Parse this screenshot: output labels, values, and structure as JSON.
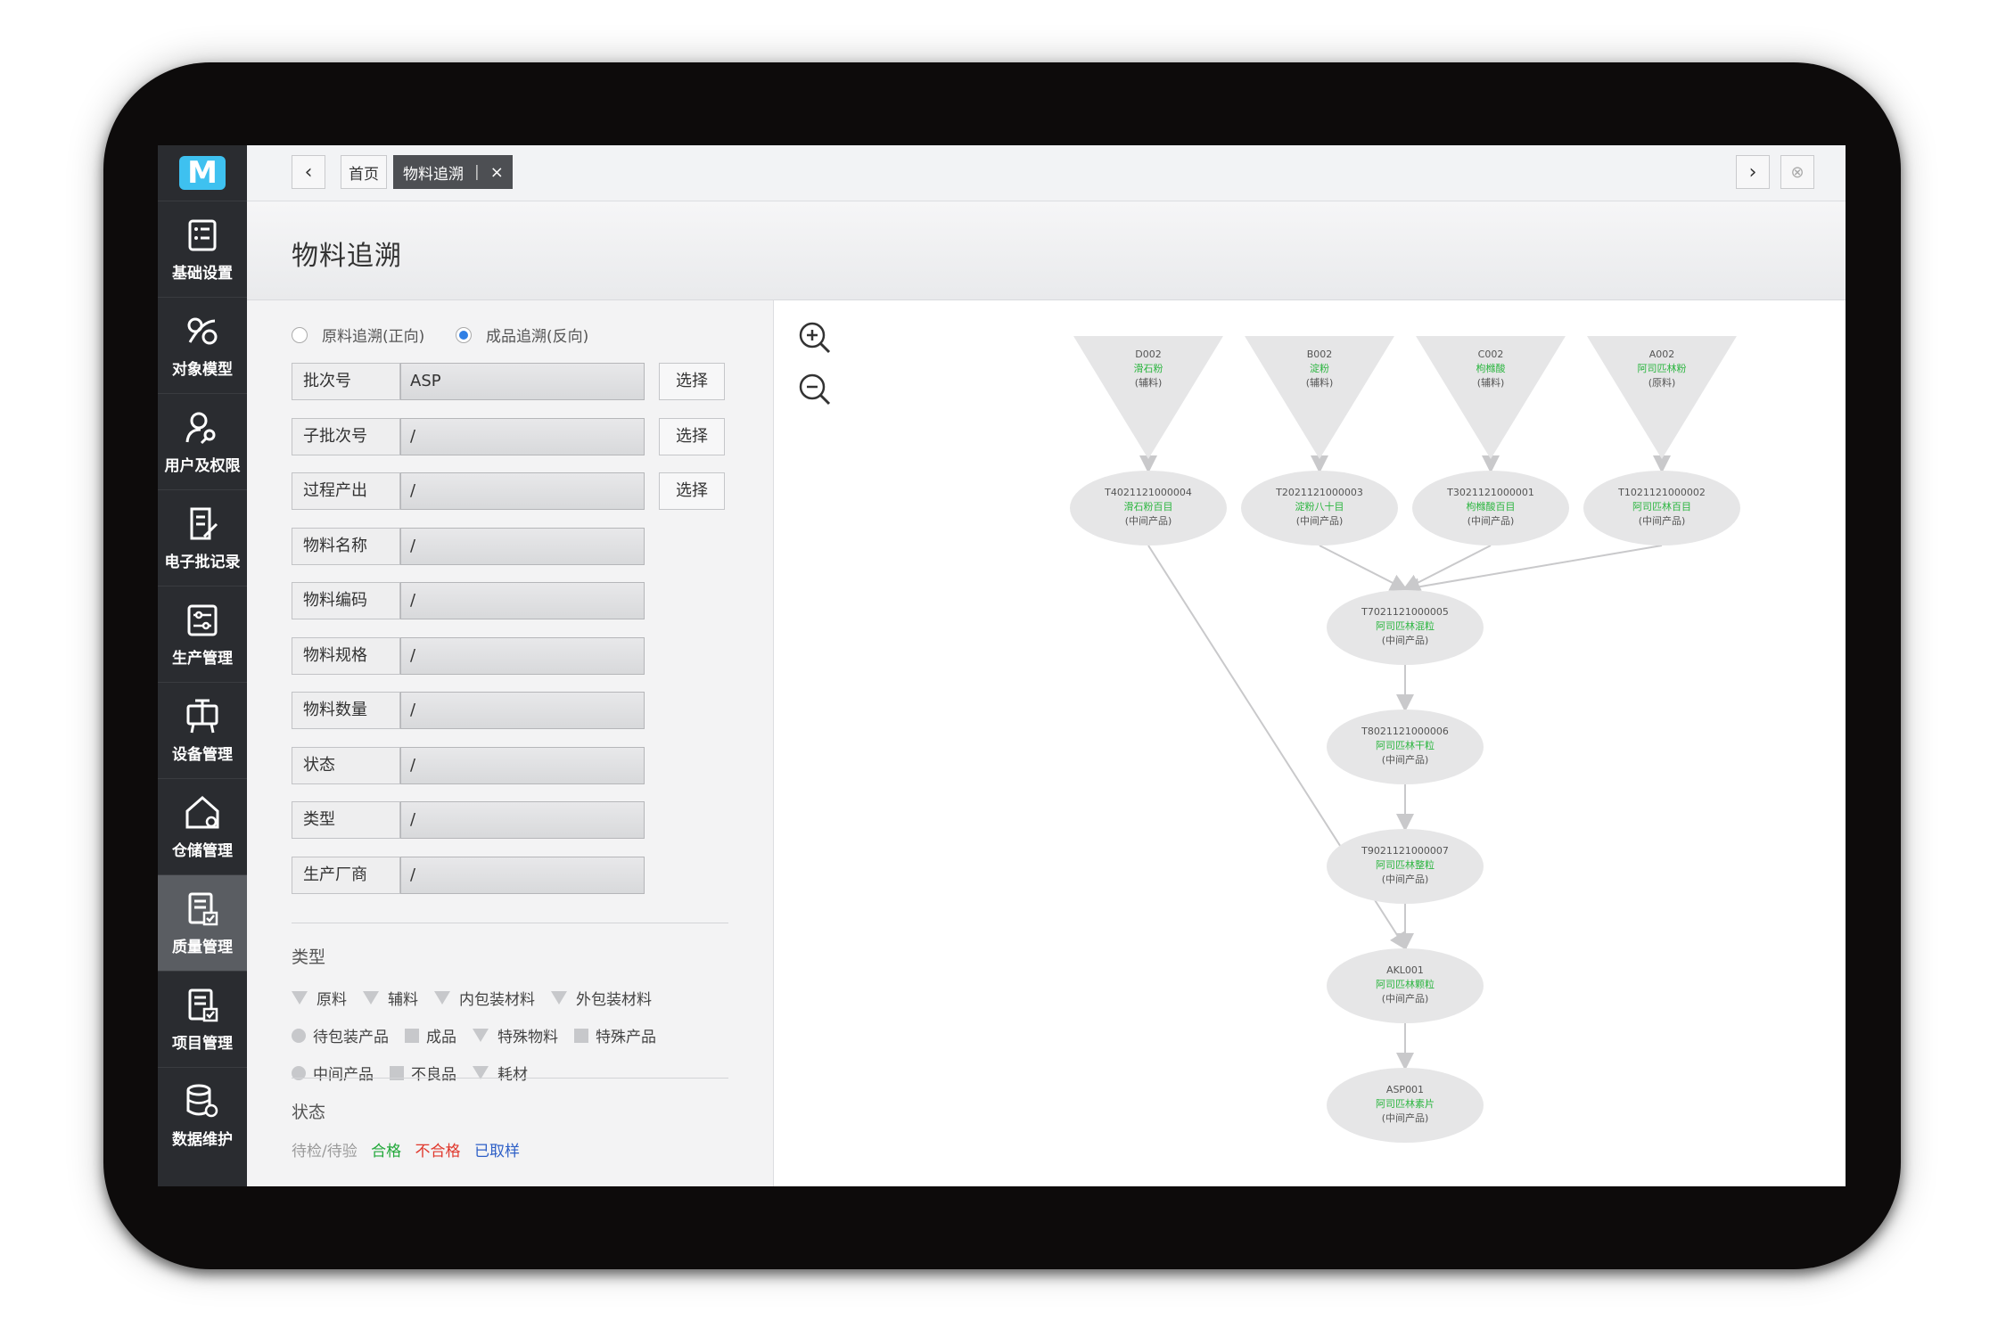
{
  "sidebar": {
    "logo": "M",
    "items": [
      {
        "label": "基础设置",
        "icon": "checklist-icon"
      },
      {
        "label": "对象模型",
        "icon": "model-link-icon"
      },
      {
        "label": "用户及权限",
        "icon": "user-key-icon"
      },
      {
        "label": "电子批记录",
        "icon": "document-edit-icon"
      },
      {
        "label": "生产管理",
        "icon": "sliders-icon"
      },
      {
        "label": "设备管理",
        "icon": "equipment-icon"
      },
      {
        "label": "仓储管理",
        "icon": "warehouse-icon"
      },
      {
        "label": "质量管理",
        "icon": "quality-check-icon",
        "active": true
      },
      {
        "label": "项目管理",
        "icon": "project-check-icon"
      },
      {
        "label": "数据维护",
        "icon": "database-gear-icon"
      }
    ]
  },
  "tabbar": {
    "prev": "‹",
    "next": "›",
    "close_all": "⊗",
    "tabs": [
      {
        "label": "首页"
      },
      {
        "label": "物料追溯",
        "active": true,
        "close": "×"
      }
    ]
  },
  "page": {
    "title": "物料追溯"
  },
  "trace_mode": {
    "forward": "原料追溯(正向)",
    "backward": "成品追溯(反向)",
    "selected": "backward"
  },
  "form": {
    "select_label": "选择",
    "fields": [
      {
        "label": "批次号",
        "value": "ASP",
        "has_select": true
      },
      {
        "label": "子批次号",
        "value": "/",
        "has_select": true
      },
      {
        "label": "过程产出",
        "value": "/",
        "has_select": true
      },
      {
        "label": "物料名称",
        "value": "/"
      },
      {
        "label": "物料编码",
        "value": "/"
      },
      {
        "label": "物料规格",
        "value": "/"
      },
      {
        "label": "物料数量",
        "value": "/"
      },
      {
        "label": "状态",
        "value": "/"
      },
      {
        "label": "类型",
        "value": "/"
      },
      {
        "label": "生产厂商",
        "value": "/"
      }
    ]
  },
  "legend": {
    "type_title": "类型",
    "rows": [
      [
        {
          "shape": "triangle",
          "label": "原料"
        },
        {
          "shape": "triangle",
          "label": "辅料"
        },
        {
          "shape": "triangle",
          "label": "内包装材料"
        },
        {
          "shape": "triangle",
          "label": "外包装材料"
        }
      ],
      [
        {
          "shape": "circle",
          "label": "待包装产品"
        },
        {
          "shape": "square",
          "label": "成品"
        },
        {
          "shape": "triangle",
          "label": "特殊物料"
        },
        {
          "shape": "square",
          "label": "特殊产品"
        }
      ],
      [
        {
          "shape": "circle",
          "label": "中间产品"
        },
        {
          "shape": "square",
          "label": "不良品"
        },
        {
          "shape": "triangle",
          "label": "耗材"
        }
      ]
    ],
    "status_title": "状态",
    "statuses": [
      {
        "label": "待检/待验",
        "color": "#9a9a9a"
      },
      {
        "label": "合格",
        "color": "#22a83a"
      },
      {
        "label": "不合格",
        "color": "#e0372b"
      },
      {
        "label": "已取样",
        "color": "#2d5fc7"
      }
    ]
  },
  "graph": {
    "zoom_in": "zoom-in-icon",
    "zoom_out": "zoom-out-icon",
    "nodes": [
      {
        "id": "D002",
        "code": "D002",
        "name": "滑石粉",
        "type": "(辅料)",
        "shape": "triangle"
      },
      {
        "id": "B002",
        "code": "B002",
        "name": "淀粉",
        "type": "(辅料)",
        "shape": "triangle"
      },
      {
        "id": "C002",
        "code": "C002",
        "name": "枸橼酸",
        "type": "(辅料)",
        "shape": "triangle"
      },
      {
        "id": "A002",
        "code": "A002",
        "name": "阿司匹林粉",
        "type": "(原料)",
        "shape": "triangle"
      },
      {
        "id": "T4",
        "code": "T4021121000004",
        "name": "滑石粉百目",
        "type": "(中间产品)",
        "shape": "ellipse"
      },
      {
        "id": "T2",
        "code": "T2021121000003",
        "name": "淀粉八十目",
        "type": "(中间产品)",
        "shape": "ellipse"
      },
      {
        "id": "T3",
        "code": "T3021121000001",
        "name": "枸橼酸百目",
        "type": "(中间产品)",
        "shape": "ellipse"
      },
      {
        "id": "T1",
        "code": "T1021121000002",
        "name": "阿司匹林百目",
        "type": "(中间产品)",
        "shape": "ellipse"
      },
      {
        "id": "T7",
        "code": "T7021121000005",
        "name": "阿司匹林混粒",
        "type": "(中间产品)",
        "shape": "ellipse"
      },
      {
        "id": "T8",
        "code": "T8021121000006",
        "name": "阿司匹林干粒",
        "type": "(中间产品)",
        "shape": "ellipse"
      },
      {
        "id": "T9",
        "code": "T9021121000007",
        "name": "阿司匹林整粒",
        "type": "(中间产品)",
        "shape": "ellipse"
      },
      {
        "id": "AKL",
        "code": "AKL001",
        "name": "阿司匹林颗粒",
        "type": "(中间产品)",
        "shape": "ellipse"
      },
      {
        "id": "ASP",
        "code": "ASP001",
        "name": "阿司匹林素片",
        "type": "(中间产品)",
        "shape": "ellipse"
      }
    ],
    "edges": [
      [
        "D002",
        "T4"
      ],
      [
        "B002",
        "T2"
      ],
      [
        "C002",
        "T3"
      ],
      [
        "A002",
        "T1"
      ],
      [
        "T2",
        "T7"
      ],
      [
        "T3",
        "T7"
      ],
      [
        "T1",
        "T7"
      ],
      [
        "T7",
        "T8"
      ],
      [
        "T8",
        "T9"
      ],
      [
        "T9",
        "AKL"
      ],
      [
        "T4",
        "AKL"
      ],
      [
        "AKL",
        "ASP"
      ]
    ],
    "name_color": "#2bb53f",
    "node_fill": "#e6e6e7",
    "edge_color": "#c9c9cb"
  }
}
